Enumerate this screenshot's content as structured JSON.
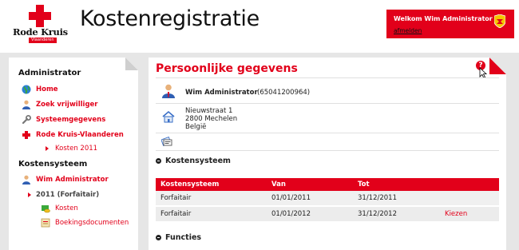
{
  "app": {
    "logo_name": "Rode Kruis",
    "logo_sub": "Vlaanderen",
    "title": "Kostenregistratie"
  },
  "user_box": {
    "welcome": "Welkom Wim Administrator",
    "logout": "afmelden"
  },
  "sidebar": {
    "admin_heading": "Administrator",
    "admin_items": [
      {
        "label": "Home",
        "icon": "globe-icon"
      },
      {
        "label": "Zoek vrijwilliger",
        "icon": "person-icon"
      },
      {
        "label": "Systeemgegevens",
        "icon": "wrench-icon"
      },
      {
        "label": "Rode Kruis-Vlaanderen",
        "icon": "red-cross-icon"
      }
    ],
    "admin_sub": "Kosten 2011",
    "kosten_heading": "Kostensysteem",
    "user_item": "Wim Administrator",
    "year_item": "2011 (Forfaitair)",
    "kosten_link": "Kosten",
    "docs_link": "Boekingsdocumenten"
  },
  "main": {
    "title": "Persoonlijke gegevens",
    "help": "?",
    "person": {
      "name": "Wim Administrator",
      "id": "(65041200964)",
      "street": "Nieuwstraat 1",
      "city": "2800 Mechelen",
      "country": "België"
    },
    "kostensysteem_heading": "Kostensysteem",
    "table": {
      "headers": [
        "Kostensysteem",
        "Van",
        "Tot",
        ""
      ],
      "rows": [
        {
          "systeem": "Forfaitair",
          "van": "01/01/2011",
          "tot": "31/12/2011",
          "action": ""
        },
        {
          "systeem": "Forfaitair",
          "van": "01/01/2012",
          "tot": "31/12/2012",
          "action": "Kiezen"
        }
      ]
    },
    "functies_heading": "Functies"
  },
  "colors": {
    "accent": "#e2001a",
    "band": "#e6e6e6"
  }
}
